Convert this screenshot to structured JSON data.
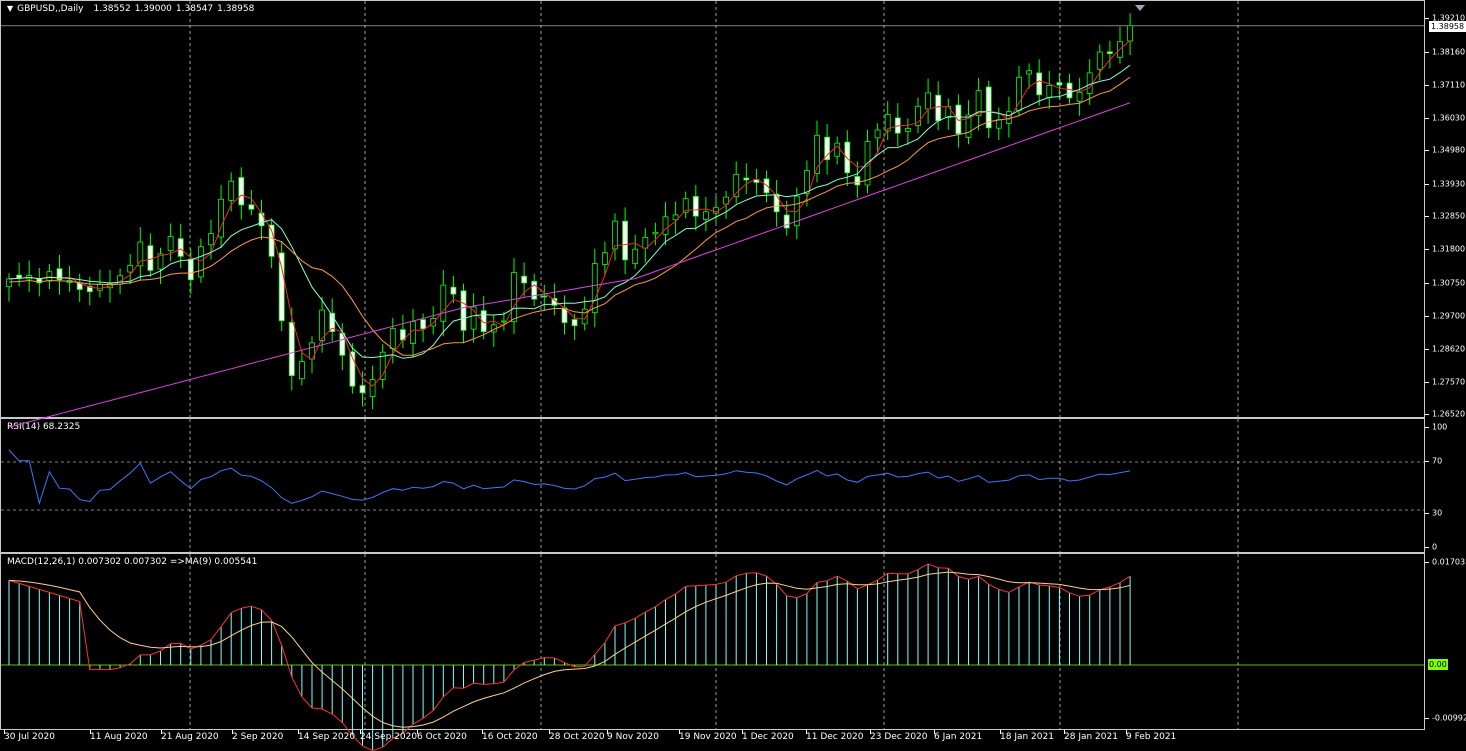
{
  "main": {
    "symbol": "GBPUSD,,Daily",
    "ohlc": [
      "1.38552",
      "1.39000",
      "1.38547",
      "1.38958"
    ],
    "current_price": "1.38958",
    "price_ticks": [
      "1.39210",
      "1.38160",
      "1.37110",
      "1.36030",
      "1.34980",
      "1.33930",
      "1.32850",
      "1.31800",
      "1.30750",
      "1.29700",
      "1.28620",
      "1.27570",
      "1.26520"
    ]
  },
  "rsi": {
    "label": "RSI(14) 68.2325",
    "ticks": [
      "100",
      "70",
      "30",
      "0"
    ],
    "levels": [
      70,
      30
    ]
  },
  "macd": {
    "label": "MACD(12,26,1) 0.007302 0.007302  =>MA(9) 0.005541",
    "ticks": [
      "0.017035",
      "0.00",
      "-0.00992"
    ]
  },
  "dates": [
    "30 Jul 2020",
    "11 Aug 2020",
    "21 Aug 2020",
    "2 Sep 2020",
    "14 Sep 2020",
    "24 Sep 2020",
    "6 Oct 2020",
    "16 Oct 2020",
    "28 Oct 2020",
    "9 Nov 2020",
    "19 Nov 2020",
    "1 Dec 2020",
    "11 Dec 2020",
    "23 Dec 2020",
    "6 Jan 2021",
    "18 Jan 2021",
    "28 Jan 2021",
    "9 Feb 2021"
  ],
  "colors": {
    "bull_candle": "#000000",
    "bear_candle": "#ffffff",
    "wick": "#00ff00",
    "ma_fast": "#ff2020",
    "ma_mid": "#7fffd4",
    "ma_slow": "#ff9a3c",
    "ma_long": "#e040e0",
    "rsi_line": "#3c78ff",
    "macd_hist": "#7fffff",
    "macd_signal": "#ff3030",
    "macd_signal2": "#ffd080",
    "grid": "#ffffff"
  },
  "chart_data": {
    "type": "candlestick",
    "closes": [
      1.3085,
      1.3088,
      1.3096,
      1.3072,
      1.3108,
      1.3082,
      1.308,
      1.3051,
      1.3044,
      1.3068,
      1.307,
      1.3095,
      1.3128,
      1.3203,
      1.3112,
      1.3165,
      1.3221,
      1.3157,
      1.3082,
      1.3188,
      1.323,
      1.334,
      1.3398,
      1.3322,
      1.3308,
      1.3255,
      1.3157,
      1.2951,
      1.2775,
      1.282,
      1.288,
      1.2985,
      1.2916,
      1.284,
      1.2741,
      1.272,
      1.2762,
      1.285,
      1.2926,
      1.2889,
      1.2948,
      1.2925,
      1.2958,
      1.3065,
      1.3036,
      1.292,
      1.2995,
      1.2916,
      1.2938,
      1.295,
      1.3105,
      1.3072,
      1.302,
      1.303,
      1.3,
      1.2945,
      1.2935,
      1.2988,
      1.3134,
      1.3169,
      1.327,
      1.3146,
      1.318,
      1.3218,
      1.3234,
      1.3284,
      1.329,
      1.3342,
      1.3286,
      1.33,
      1.3313,
      1.3347,
      1.342,
      1.3402,
      1.3394,
      1.3361,
      1.33,
      1.3248,
      1.335,
      1.3432,
      1.3545,
      1.3467,
      1.352,
      1.3425,
      1.3386,
      1.3525,
      1.3562,
      1.3612,
      1.3552,
      1.3567,
      1.3638,
      1.3681,
      1.3592,
      1.3637,
      1.355,
      1.361,
      1.3688,
      1.3569,
      1.3595,
      1.3621,
      1.3731,
      1.3752,
      1.3675,
      1.3705,
      1.3706,
      1.3665,
      1.3683,
      1.3745,
      1.3812,
      1.3807,
      1.3845,
      1.3896
    ]
  }
}
